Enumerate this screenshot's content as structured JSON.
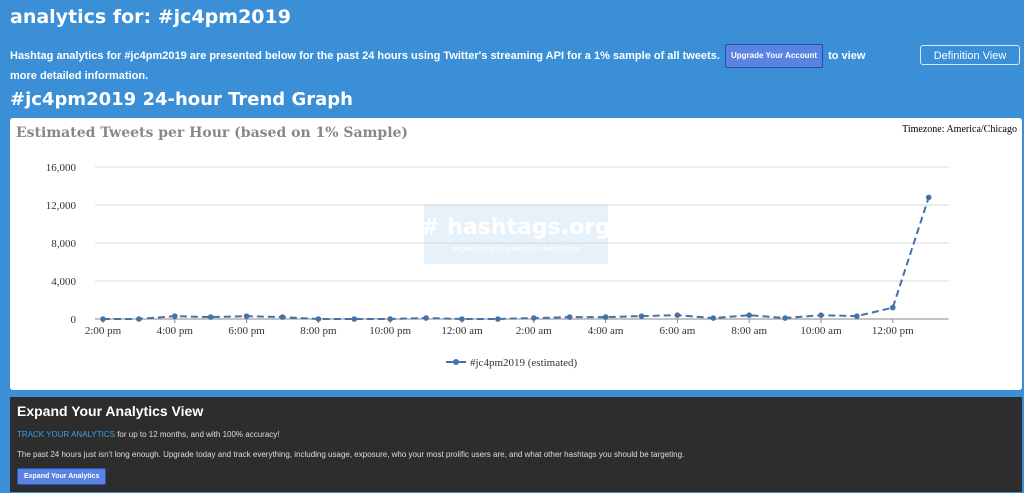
{
  "header": {
    "title": "analytics for: #jc4pm2019",
    "intro_before": "Hashtag analytics for #jc4pm2019 are presented below for the past 24 hours using Twitter's streaming API for a 1% sample of all tweets.",
    "upgrade_label": "Upgrade Your Account",
    "intro_after": "to view more detailed information.",
    "definition_view_label": "Definition View",
    "trend_title": "#jc4pm2019 24-hour Trend Graph"
  },
  "chart_data": {
    "type": "line",
    "title": "Estimated Tweets per Hour (based on 1% Sample)",
    "timezone": "Timezone: America/Chicago",
    "watermark_main": "# hashtags.org",
    "watermark_sub": "organizing the world's hashtags",
    "x_tick_labels": [
      "2:00 pm",
      "4:00 pm",
      "6:00 pm",
      "8:00 pm",
      "10:00 pm",
      "12:00 am",
      "2:00 am",
      "4:00 am",
      "6:00 am",
      "8:00 am",
      "10:00 am",
      "12:00 pm"
    ],
    "y_tick_labels": [
      "0",
      "4,000",
      "8,000",
      "12,000",
      "16,000"
    ],
    "ylim": [
      0,
      16000
    ],
    "grid": true,
    "legend_position": "bottom-center",
    "color": "#4572a7",
    "series": [
      {
        "name": "#jc4pm2019 (estimated)",
        "values": [
          0,
          0,
          300,
          200,
          300,
          200,
          0,
          0,
          0,
          100,
          0,
          0,
          100,
          200,
          200,
          300,
          400,
          100,
          400,
          100,
          400,
          300,
          1200,
          12800
        ]
      }
    ]
  },
  "expand": {
    "title": "Expand Your Analytics View",
    "track_link": "TRACK YOUR ANALYTICS",
    "track_rest": "for up to 12 months, and with 100% accuracy!",
    "description": "The past 24 hours just isn't long enough. Upgrade today and track everything, including usage, exposure, who your most prolific users are, and what other hashtags you should be targeting.",
    "button_label": "Expand Your Analytics"
  }
}
